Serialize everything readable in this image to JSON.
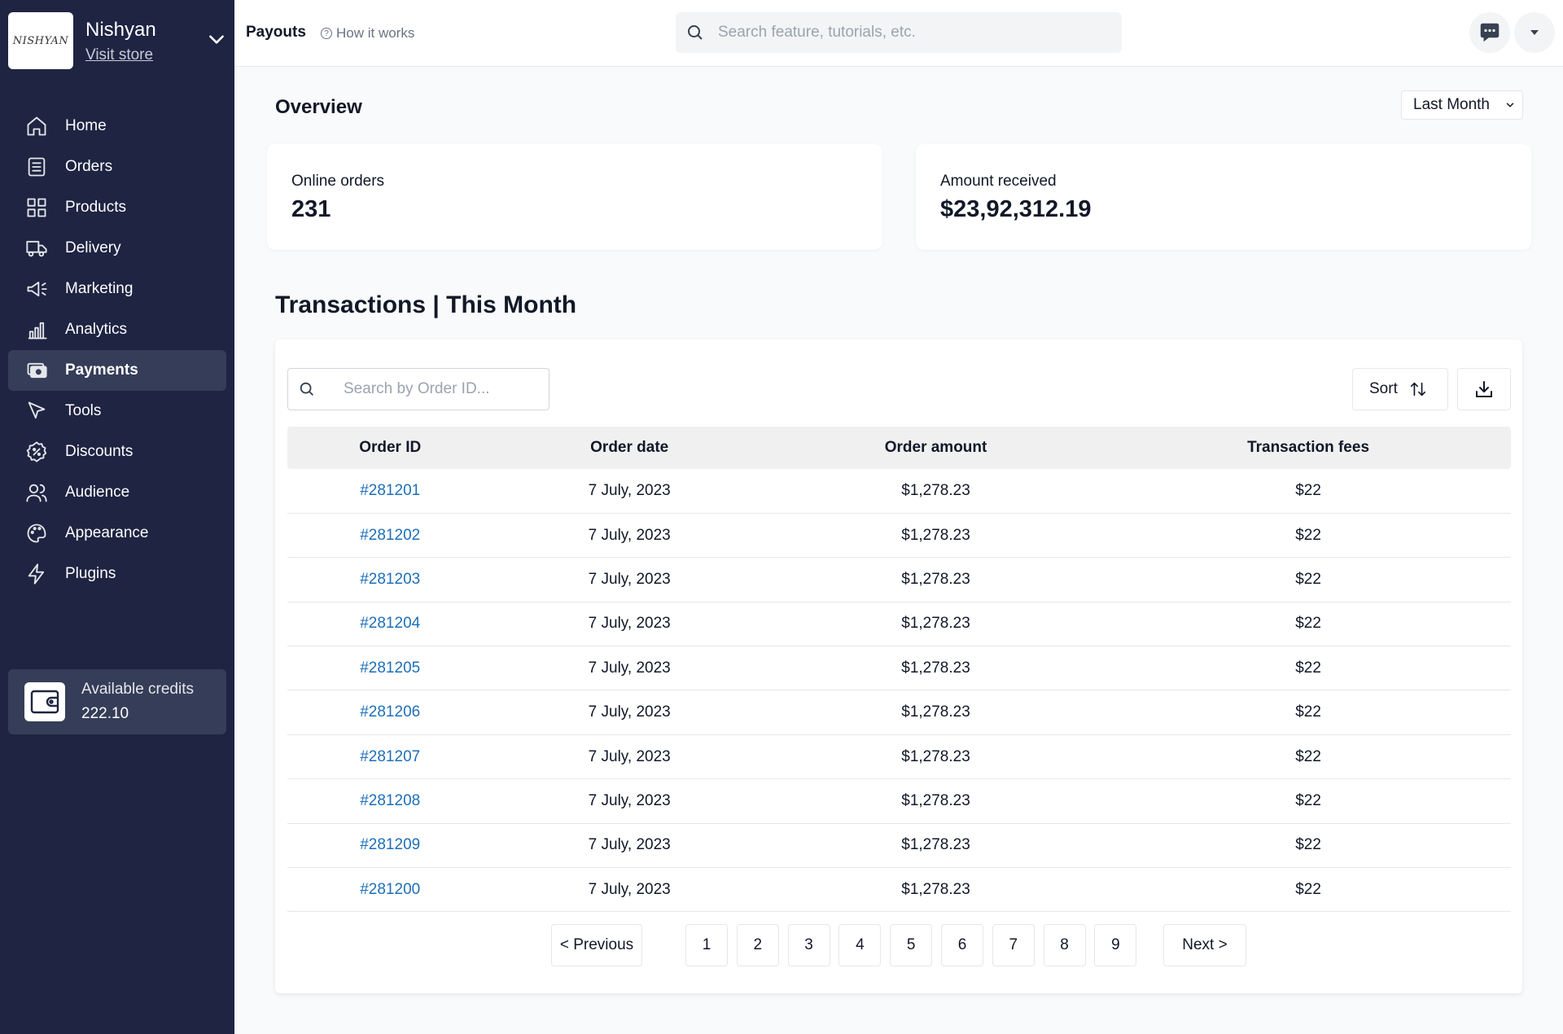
{
  "store": {
    "logo_text": "NISHYAN",
    "name": "Nishyan",
    "visit_link": "Visit store"
  },
  "sidebar": {
    "items": [
      {
        "label": "Home",
        "icon": "home-icon"
      },
      {
        "label": "Orders",
        "icon": "orders-icon"
      },
      {
        "label": "Products",
        "icon": "grid-icon"
      },
      {
        "label": "Delivery",
        "icon": "truck-icon"
      },
      {
        "label": "Marketing",
        "icon": "megaphone-icon"
      },
      {
        "label": "Analytics",
        "icon": "bar-chart-icon"
      },
      {
        "label": "Payments",
        "icon": "payments-icon",
        "active": true
      },
      {
        "label": "Tools",
        "icon": "cursor-icon"
      },
      {
        "label": "Discounts",
        "icon": "discount-icon"
      },
      {
        "label": "Audience",
        "icon": "users-icon"
      },
      {
        "label": "Appearance",
        "icon": "palette-icon"
      },
      {
        "label": "Plugins",
        "icon": "lightning-icon"
      }
    ],
    "credits": {
      "label": "Available credits",
      "value": "222.10"
    }
  },
  "topbar": {
    "title": "Payouts",
    "how_it_works": "How it works",
    "search_placeholder": "Search feature, tutorials, etc."
  },
  "overview": {
    "title": "Overview",
    "period": "Last Month",
    "stats": [
      {
        "label": "Online orders",
        "value": "231"
      },
      {
        "label": "Amount received",
        "value": "$23,92,312.19"
      }
    ]
  },
  "transactions": {
    "title": "Transactions | This Month",
    "search_placeholder": "Search by Order ID...",
    "sort_label": "Sort",
    "columns": [
      "Order ID",
      "Order date",
      "Order amount",
      "Transaction fees"
    ],
    "rows": [
      [
        "#281201",
        "7 July, 2023",
        "$1,278.23",
        "$22"
      ],
      [
        "#281202",
        "7 July, 2023",
        "$1,278.23",
        "$22"
      ],
      [
        "#281203",
        "7 July, 2023",
        "$1,278.23",
        "$22"
      ],
      [
        "#281204",
        "7 July, 2023",
        "$1,278.23",
        "$22"
      ],
      [
        "#281205",
        "7 July, 2023",
        "$1,278.23",
        "$22"
      ],
      [
        "#281206",
        "7 July, 2023",
        "$1,278.23",
        "$22"
      ],
      [
        "#281207",
        "7 July, 2023",
        "$1,278.23",
        "$22"
      ],
      [
        "#281208",
        "7 July, 2023",
        "$1,278.23",
        "$22"
      ],
      [
        "#281209",
        "7 July, 2023",
        "$1,278.23",
        "$22"
      ],
      [
        "#281200",
        "7 July, 2023",
        "$1,278.23",
        "$22"
      ]
    ],
    "pagination": {
      "previous": "< Previous",
      "pages": [
        "1",
        "2",
        "3",
        "4",
        "5",
        "6",
        "7",
        "8",
        "9"
      ],
      "next": "Next >"
    }
  },
  "colors": {
    "sidebar_bg": "#1e2442",
    "sidebar_active": "#363d59",
    "link": "#1d6fb8",
    "page_bg": "#f9fafb"
  }
}
